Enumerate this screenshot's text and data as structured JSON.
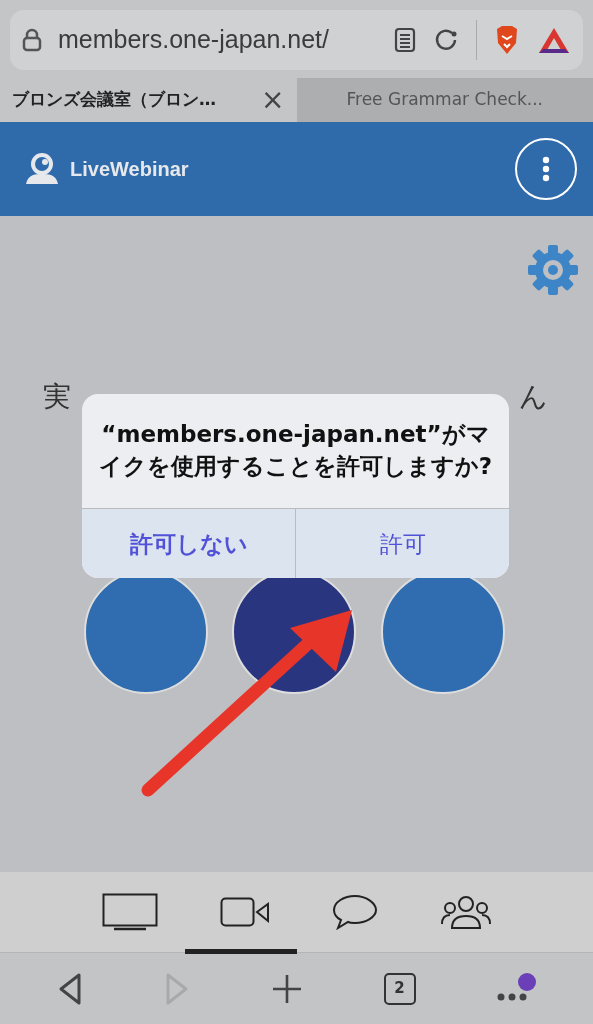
{
  "address_bar": {
    "url": "members.one-japan.net/"
  },
  "tabs": [
    {
      "title": "ブロンズ会議室（ブロン…",
      "selected": true,
      "close": "×"
    },
    {
      "title": "Free Grammar Check...",
      "selected": false
    }
  ],
  "header": {
    "brand": "LiveWebinar"
  },
  "message_parts": [
    "実",
    "ん"
  ],
  "call_buttons": [
    {
      "color": "#2f6db0"
    },
    {
      "color": "#2a3580"
    },
    {
      "color": "#2f6db0"
    }
  ],
  "dialog": {
    "title": "“members.one-japan.net”がマイクを使用することを許可しますか?",
    "buttons": [
      {
        "label": "許可しない",
        "bold": true
      },
      {
        "label": "許可",
        "bold": false
      }
    ]
  },
  "nav_buttons": [
    {
      "kind": "back",
      "disabled": false
    },
    {
      "kind": "forward",
      "disabled": true
    }
  ],
  "tab_count": "2"
}
